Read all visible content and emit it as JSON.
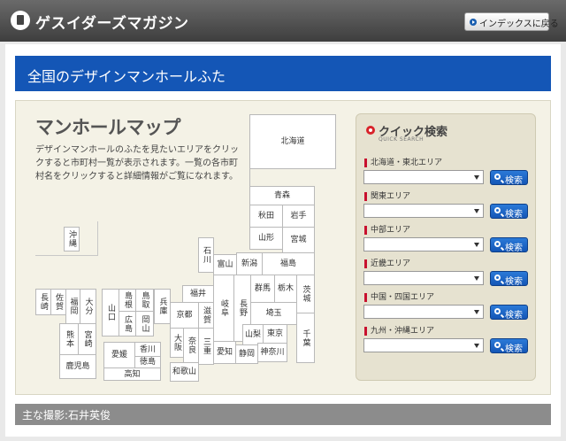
{
  "header": {
    "site_title": "ゲスイダーズマガジン",
    "index_button_label": "インデックスに戻る"
  },
  "page": {
    "title": "全国のデザインマンホールふた"
  },
  "map": {
    "title": "マンホールマップ",
    "description": "デザインマンホールのふたを見たいエリアをクリックすると市町村一覧が表示されます。一覧の各市町村名をクリックすると詳細情報がご覧になれます。",
    "prefectures": {
      "hokkaido": "北海道",
      "aomori": "青森",
      "akita": "秋田",
      "iwate": "岩手",
      "yamagata": "山形",
      "miyagi": "宮城",
      "ishikawa": "石川",
      "toyama": "富山",
      "niigata": "新潟",
      "fukushima": "福島",
      "fukui": "福井",
      "gifu": "岐阜",
      "nagano": "長野",
      "gunma": "群馬",
      "tochigi": "栃木",
      "ibaraki": "茨城",
      "shiga": "滋賀",
      "saitama": "埼玉",
      "kyoto": "京都",
      "yamanashi": "山梨",
      "tokyo": "東京",
      "chiba": "千葉",
      "kanagawa": "神奈川",
      "shizuoka": "静岡",
      "aichi": "愛知",
      "mie": "三重",
      "nara": "奈良",
      "osaka": "大阪",
      "hyogo": "兵庫",
      "wakayama": "和歌山",
      "shimane": "島根",
      "tottori": "鳥取",
      "yamaguchi": "山口",
      "hiroshima": "広島",
      "okayama": "岡山",
      "kagawa": "香川",
      "ehime": "愛媛",
      "tokushima": "徳島",
      "kochi": "高知",
      "nagasaki": "長崎",
      "saga": "佐賀",
      "fukuoka": "福岡",
      "oita": "大分",
      "kumamoto": "熊本",
      "miyazaki": "宮崎",
      "kagoshima": "鹿児島",
      "okinawa": "沖縄"
    }
  },
  "quick_search": {
    "title": "クイック検索",
    "subtitle": "QUICK SEARCH",
    "search_label": "検索",
    "areas": [
      {
        "label": "北海道・東北エリア",
        "selected": ""
      },
      {
        "label": "関東エリア",
        "selected": ""
      },
      {
        "label": "中部エリア",
        "selected": ""
      },
      {
        "label": "近畿エリア",
        "selected": ""
      },
      {
        "label": "中国・四国エリア",
        "selected": ""
      },
      {
        "label": "九州・沖縄エリア",
        "selected": ""
      }
    ]
  },
  "footer": {
    "credit": "主な撮影:石井英俊"
  },
  "colors": {
    "header_bg": "#4a4a4a",
    "title_bar_bg": "#1456b6",
    "map_panel_bg": "#f4f2e6",
    "accent_red": "#c8102e",
    "footer_bg": "#8c8c8c"
  },
  "icons": {
    "logo": "book-icon",
    "index_arrow": "arrow-right-circle-icon",
    "quick_search": "target-icon",
    "search": "magnifier-icon",
    "dropdown": "caret-down-icon"
  }
}
